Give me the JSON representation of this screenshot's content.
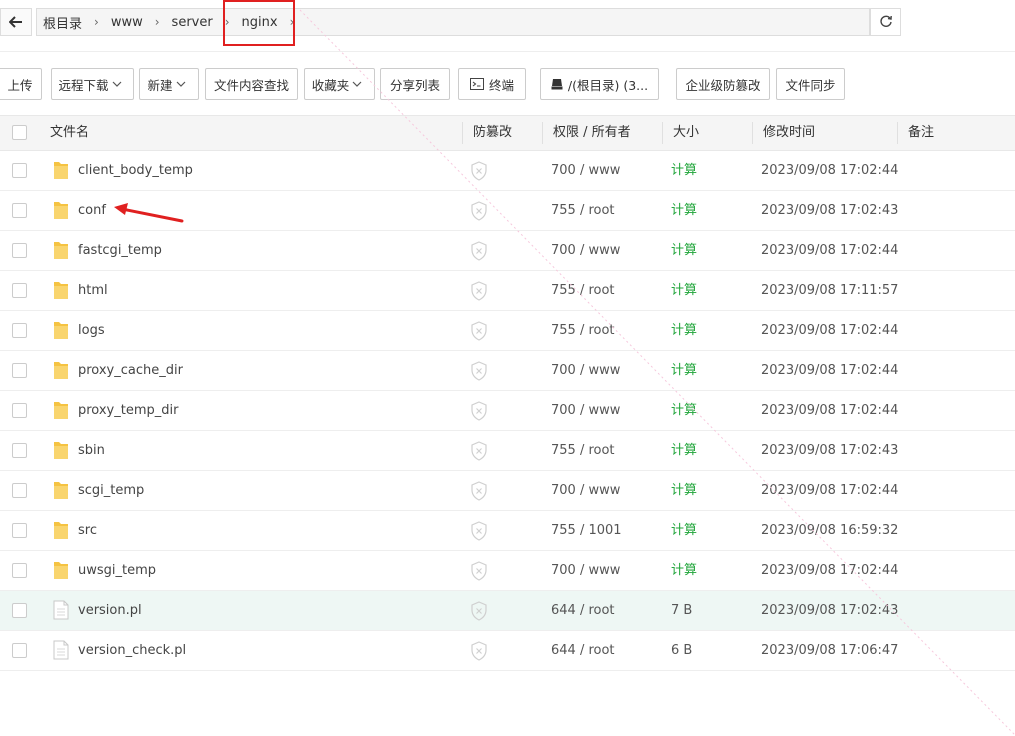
{
  "path": {
    "crumbs": [
      "根目录",
      "www",
      "server",
      "nginx"
    ]
  },
  "toolbar": {
    "upload": "上传",
    "remote_download": "远程下载",
    "new": "新建",
    "content_search": "文件内容查找",
    "favorites": "收藏夹",
    "share_list": "分享列表",
    "terminal": "终端",
    "disk": "/(根目录) (3...",
    "tamper_proof": "企业级防篡改",
    "file_sync": "文件同步"
  },
  "table": {
    "headers": {
      "name": "文件名",
      "protect": "防篡改",
      "perm": "权限 / 所有者",
      "size": "大小",
      "mtime": "修改时间",
      "note": "备注"
    },
    "rows": [
      {
        "type": "folder",
        "name": "client_body_temp",
        "perm": "700 / www",
        "size": "计算",
        "mtime": "2023/09/08 17:02:44"
      },
      {
        "type": "folder",
        "name": "conf",
        "perm": "755 / root",
        "size": "计算",
        "mtime": "2023/09/08 17:02:43"
      },
      {
        "type": "folder",
        "name": "fastcgi_temp",
        "perm": "700 / www",
        "size": "计算",
        "mtime": "2023/09/08 17:02:44"
      },
      {
        "type": "folder",
        "name": "html",
        "perm": "755 / root",
        "size": "计算",
        "mtime": "2023/09/08 17:11:57"
      },
      {
        "type": "folder",
        "name": "logs",
        "perm": "755 / root",
        "size": "计算",
        "mtime": "2023/09/08 17:02:44"
      },
      {
        "type": "folder",
        "name": "proxy_cache_dir",
        "perm": "700 / www",
        "size": "计算",
        "mtime": "2023/09/08 17:02:44"
      },
      {
        "type": "folder",
        "name": "proxy_temp_dir",
        "perm": "700 / www",
        "size": "计算",
        "mtime": "2023/09/08 17:02:44"
      },
      {
        "type": "folder",
        "name": "sbin",
        "perm": "755 / root",
        "size": "计算",
        "mtime": "2023/09/08 17:02:43"
      },
      {
        "type": "folder",
        "name": "scgi_temp",
        "perm": "700 / www",
        "size": "计算",
        "mtime": "2023/09/08 17:02:44"
      },
      {
        "type": "folder",
        "name": "src",
        "perm": "755 / 1001",
        "size": "计算",
        "mtime": "2023/09/08 16:59:32"
      },
      {
        "type": "folder",
        "name": "uwsgi_temp",
        "perm": "700 / www",
        "size": "计算",
        "mtime": "2023/09/08 17:02:44"
      },
      {
        "type": "file",
        "name": "version.pl",
        "perm": "644 / root",
        "size": "7 B",
        "mtime": "2023/09/08 17:02:43",
        "selected": true
      },
      {
        "type": "file",
        "name": "version_check.pl",
        "perm": "644 / root",
        "size": "6 B",
        "mtime": "2023/09/08 17:06:47"
      }
    ]
  },
  "colors": {
    "calc_green": "#20a53a",
    "highlight_red": "#e02020",
    "selected_row": "#eef7f4",
    "folder_yellow": "#f5c342"
  }
}
